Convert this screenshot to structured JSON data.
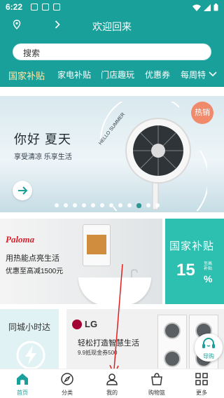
{
  "status": {
    "time": "6:22"
  },
  "header": {
    "welcome": "欢迎回来"
  },
  "search": {
    "label": "搜索"
  },
  "categories": [
    {
      "label": "国家补贴",
      "active": true
    },
    {
      "label": "家电补贴",
      "active": false
    },
    {
      "label": "门店趣玩",
      "active": false
    },
    {
      "label": "优惠券",
      "active": false
    },
    {
      "label": "每周特",
      "active": false
    }
  ],
  "banner": {
    "title": "你好 夏天",
    "subtitle": "享受清凉  乐享生活",
    "arc_text": "HELLO SUMMER",
    "hot_badge": "热销",
    "slide_count": 12,
    "active_slide": 10
  },
  "promo_paloma": {
    "brand": "Paloma",
    "line1": "用热能点亮生活",
    "line2": "优惠至高减1500元"
  },
  "promo_gov": {
    "title": "国家补贴",
    "percent": "15",
    "percent_sign": "%",
    "percent_note": "至高补贴"
  },
  "promo_local": {
    "title": "同城小时达"
  },
  "promo_lg": {
    "brand": "LG",
    "line1": "轻松打造智慧生活",
    "line2": "9.9抵现金券500"
  },
  "service_button": {
    "label": "导购"
  },
  "bottom_nav": [
    {
      "label": "首页",
      "icon": "home-icon",
      "active": true
    },
    {
      "label": "分类",
      "icon": "compass-icon",
      "active": false
    },
    {
      "label": "我的",
      "icon": "user-icon",
      "active": false
    },
    {
      "label": "购物篮",
      "icon": "basket-icon",
      "active": false
    },
    {
      "label": "更多",
      "icon": "grid-icon",
      "active": false
    }
  ],
  "colors": {
    "brand_teal": "#1aa09a",
    "active_category": "#ffe9a8",
    "hot_badge": "#f08a6a",
    "annotation_arrow": "#e02020"
  }
}
